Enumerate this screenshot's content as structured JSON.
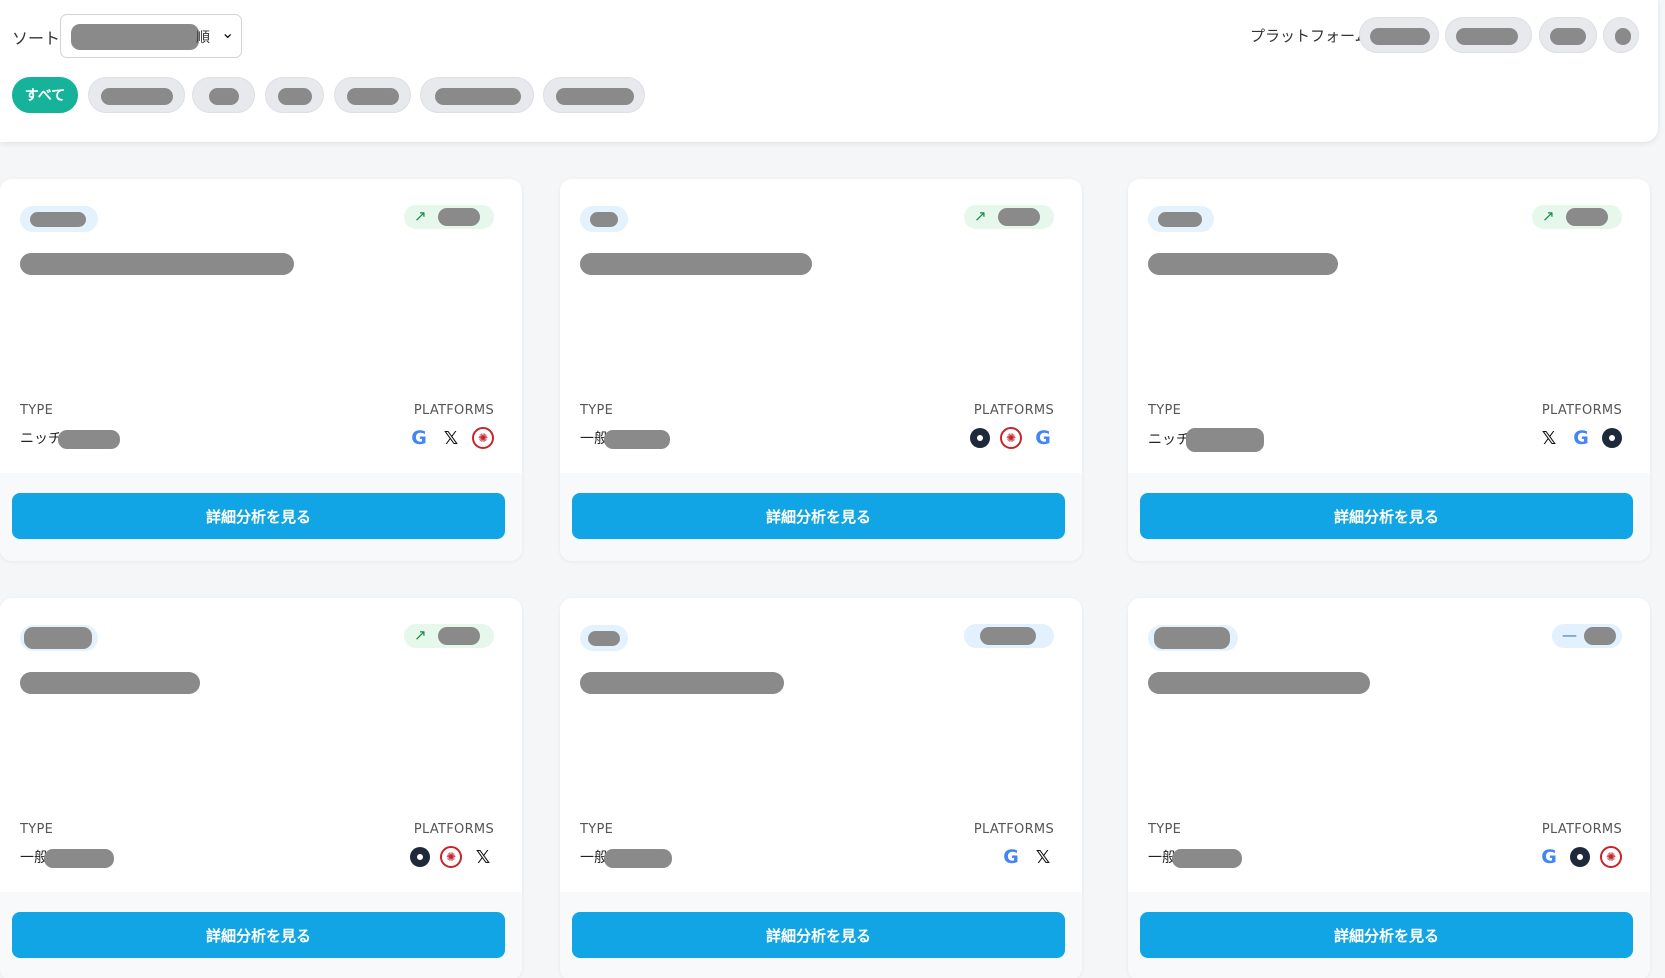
{
  "sort": {
    "label": "ソート:",
    "suffix": "順"
  },
  "platform_filter": {
    "label": "プラットフォーム:"
  },
  "categories": {
    "active_label": "すべて"
  },
  "cards": [
    {
      "type_label": "TYPE",
      "type_value": "ニッチ",
      "platforms_label": "PLATFORMS",
      "button_label": "詳細分析を見る",
      "description": "",
      "platforms": [
        "google-icon",
        "x-icon",
        "red-circle-icon"
      ]
    },
    {
      "type_label": "TYPE",
      "type_value": "一般",
      "platforms_label": "PLATFORMS",
      "button_label": "詳細分析を見る",
      "description": "",
      "platforms": [
        "dark-dot-icon",
        "red-circle-icon",
        "google-icon"
      ]
    },
    {
      "type_label": "TYPE",
      "type_value": "ニッチ",
      "platforms_label": "PLATFORMS",
      "button_label": "詳細分析を見る",
      "description": "",
      "platforms": [
        "x-icon",
        "google-icon",
        "dark-dot-icon"
      ]
    },
    {
      "type_label": "TYPE",
      "type_value": "一般",
      "platforms_label": "PLATFORMS",
      "button_label": "詳細分析を見る",
      "description": "",
      "platforms": [
        "dark-dot-icon",
        "red-circle-icon",
        "x-icon"
      ]
    },
    {
      "type_label": "TYPE",
      "type_value": "一般",
      "platforms_label": "PLATFORMS",
      "button_label": "詳細分析を見る",
      "description": "",
      "platforms": [
        "google-icon",
        "x-icon"
      ]
    },
    {
      "type_label": "TYPE",
      "type_value": "一般",
      "platforms_label": "PLATFORMS",
      "button_label": "詳細分析を見る",
      "description": "",
      "platforms": [
        "google-icon",
        "dark-dot-icon",
        "red-circle-icon"
      ]
    }
  ],
  "icons": {
    "google": "G",
    "x": "𝕏",
    "red_circle": "✺",
    "trend_up": "↗",
    "trend_flat": "—",
    "chevron": "⌄"
  },
  "colors": {
    "accent_button": "#12a5e6",
    "active_chip": "#16b39a",
    "trend_up_bg": "#e6f7ec",
    "category_badge_bg": "#e3f2fd"
  }
}
